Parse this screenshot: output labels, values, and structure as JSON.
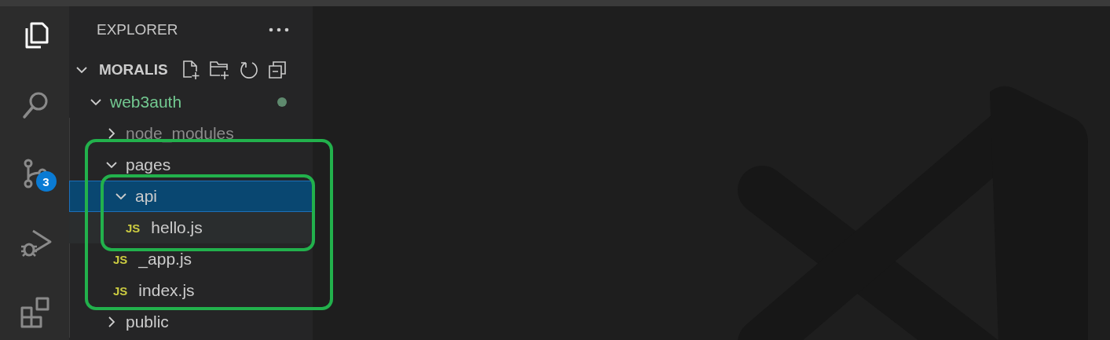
{
  "activity_bar": [
    {
      "kind": "explorer",
      "selected": true
    },
    {
      "kind": "search",
      "selected": false
    },
    {
      "kind": "source-control",
      "selected": false,
      "badge": "3"
    },
    {
      "kind": "run-debug",
      "selected": false
    },
    {
      "kind": "extensions",
      "selected": false
    }
  ],
  "sidebar": {
    "title": "EXPLORER",
    "section": {
      "title": "MORALIS",
      "expanded": true,
      "tree": [
        {
          "name": "web3auth",
          "kind": "folder",
          "expanded": true,
          "modified": true,
          "children": [
            {
              "name": "node_modules",
              "kind": "folder",
              "expanded": false,
              "ignored": true
            },
            {
              "name": "pages",
              "kind": "folder",
              "expanded": true,
              "outlined": true,
              "children": [
                {
                  "name": "api",
                  "kind": "folder",
                  "expanded": true,
                  "selected": true,
                  "outlined": true,
                  "children": [
                    {
                      "name": "hello.js",
                      "kind": "file",
                      "icon": "JS",
                      "hovered": true
                    }
                  ]
                },
                {
                  "name": "_app.js",
                  "kind": "file",
                  "icon": "JS"
                },
                {
                  "name": "index.js",
                  "kind": "file",
                  "icon": "JS"
                }
              ]
            },
            {
              "name": "public",
              "kind": "folder",
              "expanded": false
            }
          ]
        }
      ]
    }
  }
}
